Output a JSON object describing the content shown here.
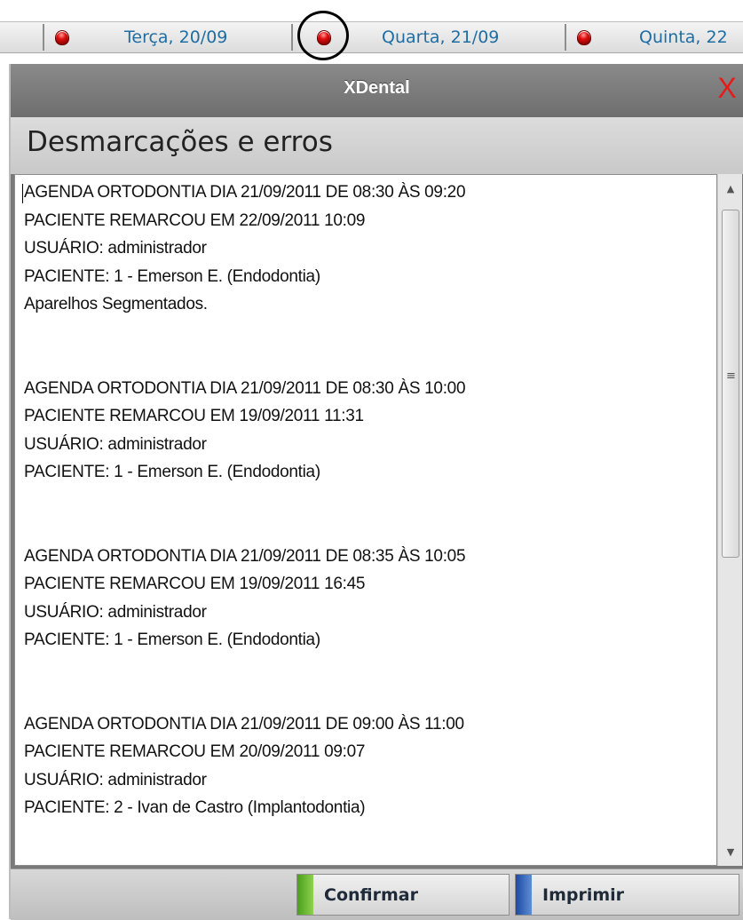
{
  "day_tabs": [
    {
      "label": "Terça, 20/09"
    },
    {
      "label": "Quarta, 21/09"
    },
    {
      "label": "Quinta, 22"
    }
  ],
  "dialog": {
    "title": "XDental",
    "close_label": "X",
    "heading": "Desmarcações e erros",
    "entries": [
      {
        "lines": [
          "AGENDA ORTODONTIA DIA 21/09/2011 DE 08:30 ÀS 09:20",
          "PACIENTE REMARCOU EM 22/09/2011 10:09",
          "USUÁRIO: administrador",
          "PACIENTE: 1 - Emerson E. (Endodontia)",
          "Aparelhos Segmentados."
        ]
      },
      {
        "lines": [
          "AGENDA ORTODONTIA DIA 21/09/2011 DE 08:30 ÀS 10:00",
          "PACIENTE REMARCOU EM 19/09/2011 11:31",
          "USUÁRIO: administrador",
          "PACIENTE: 1 - Emerson E. (Endodontia)"
        ]
      },
      {
        "lines": [
          "AGENDA ORTODONTIA DIA 21/09/2011 DE 08:35 ÀS 10:05",
          "PACIENTE REMARCOU EM 19/09/2011 16:45",
          "USUÁRIO: administrador",
          "PACIENTE: 1 - Emerson E. (Endodontia)"
        ]
      },
      {
        "lines": [
          "AGENDA ORTODONTIA DIA 21/09/2011 DE 09:00 ÀS 11:00",
          "PACIENTE REMARCOU EM 20/09/2011 09:07",
          "USUÁRIO: administrador",
          "PACIENTE: 2 - Ivan de Castro (Implantodontia)"
        ]
      }
    ],
    "buttons": {
      "confirm_label": "Confirmar",
      "print_label": "Imprimir"
    }
  },
  "icons": {
    "day_status": "red-bulb-icon",
    "scroll_up": "up-arrow-icon",
    "scroll_down": "down-arrow-icon",
    "scroll_grip": "grip-icon"
  },
  "colors": {
    "day_label": "#1f6ea3",
    "close": "#e51b1b",
    "confirm_accent": "#4a9f1c",
    "print_accent": "#1c4aa0"
  }
}
